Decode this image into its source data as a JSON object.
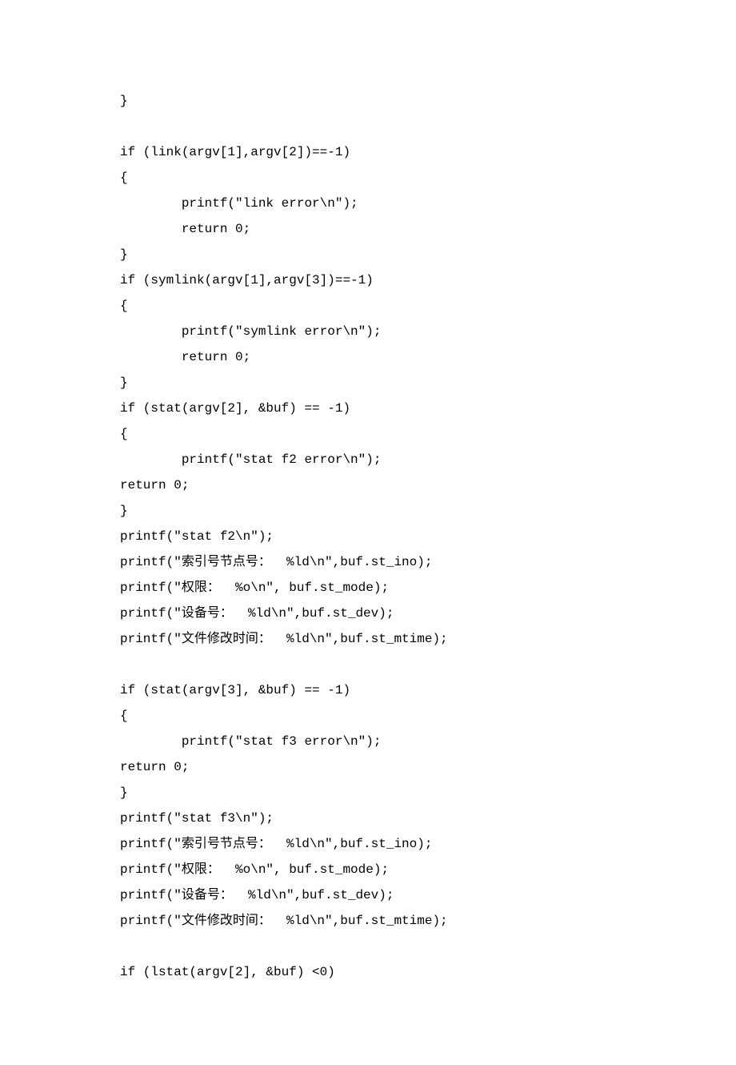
{
  "code": {
    "lines": [
      "}",
      "",
      "if (link(argv[1],argv[2])==-1)",
      "{",
      "        printf(\"link error\\n\");",
      "        return 0;",
      "}",
      "if (symlink(argv[1],argv[3])==-1)",
      "{",
      "        printf(\"symlink error\\n\");",
      "        return 0;",
      "}",
      "if (stat(argv[2], &buf) == -1)",
      "{",
      "        printf(\"stat f2 error\\n\");",
      "return 0;",
      "}",
      "printf(\"stat f2\\n\");",
      "printf(\"索引号节点号：  %ld\\n\",buf.st_ino);",
      "printf(\"权限：  %o\\n\", buf.st_mode);",
      "printf(\"设备号：  %ld\\n\",buf.st_dev);",
      "printf(\"文件修改时间：  %ld\\n\",buf.st_mtime);",
      "",
      "if (stat(argv[3], &buf) == -1)",
      "{",
      "        printf(\"stat f3 error\\n\");",
      "return 0;",
      "}",
      "printf(\"stat f3\\n\");",
      "printf(\"索引号节点号：  %ld\\n\",buf.st_ino);",
      "printf(\"权限：  %o\\n\", buf.st_mode);",
      "printf(\"设备号：  %ld\\n\",buf.st_dev);",
      "printf(\"文件修改时间：  %ld\\n\",buf.st_mtime);",
      "",
      "if (lstat(argv[2], &buf) <0)"
    ]
  }
}
